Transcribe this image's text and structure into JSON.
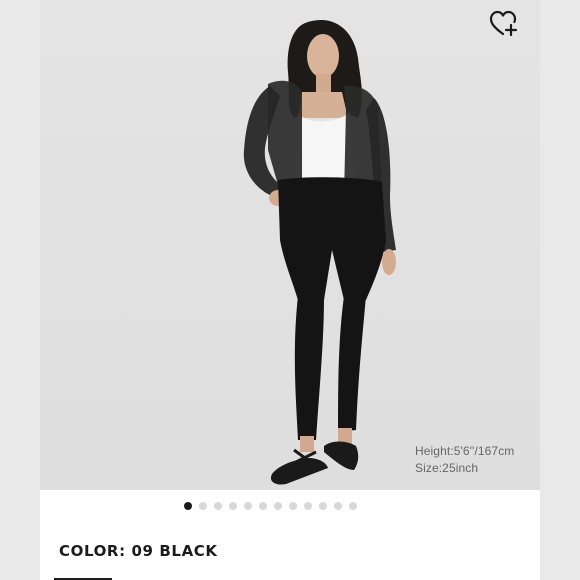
{
  "product_gallery": {
    "model_info": {
      "height": "Height:5'6''/167cm",
      "size": "Size:25inch"
    },
    "image_count": 12,
    "active_index": 0,
    "wishlist_icon": "heart-plus-icon"
  },
  "product_details": {
    "color_label": "COLOR: 09 BLACK"
  },
  "colors": {
    "photo_background": "#e2e2e2",
    "dot_active": "#1b1b1b",
    "dot_inactive": "#d8d8d8",
    "text_primary": "#1b1b1b"
  }
}
